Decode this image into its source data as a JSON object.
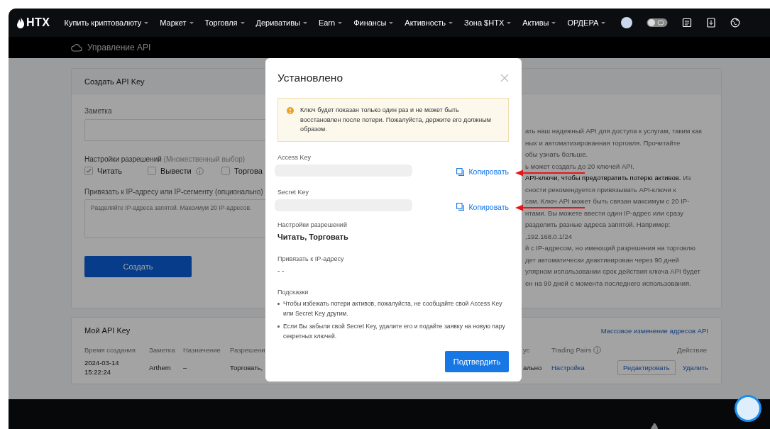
{
  "nav": {
    "logo": "HTX",
    "items": [
      {
        "label": "Купить криптовалюту"
      },
      {
        "label": "Маркет"
      },
      {
        "label": "Торговля"
      },
      {
        "label": "Деривативы"
      },
      {
        "label": "Earn"
      },
      {
        "label": "Финансы"
      },
      {
        "label": "Активность"
      },
      {
        "label": "Зона $HTX"
      },
      {
        "label": "Активы"
      },
      {
        "label": "ОРДЕРА"
      }
    ]
  },
  "subheader": {
    "title": "Управление API"
  },
  "create_panel": {
    "title": "Создать API Key",
    "note_label": "Заметка",
    "permissions_label": "Настройки разрешений",
    "permissions_hint": "(Множественный выбор)",
    "permissions": [
      {
        "label": "Читать",
        "checked": true,
        "info": false
      },
      {
        "label": "Вывести",
        "checked": false,
        "info": true
      },
      {
        "label": "Торгова",
        "checked": false,
        "info": false
      }
    ],
    "ip_label": "Привязать к IP-адресу или IP-сегменту (опционально)",
    "ip_placeholder": "Разделяйте IP-адреса запятой. Максимум 20 IP-адресов.",
    "create_button": "Создать",
    "info_lines": [
      "ать наш надежный API для доступа к услугам, таким как",
      "ных и автоматизированная торговля. Прочитайте",
      "обы узнать больше.",
      "ь может создать до 20 ключей API.",
      "**API-ключи, чтобы предотвратить потерю активов.** Из",
      "сности рекомендуется привязывать API-ключи к",
      "сам. Ключ API может быть связан максимум с 20 IP-",
      "нтами. Вы можете ввести один IP-адрес или сразу",
      "разделить разные адреса запятой. Например:",
      ",192.168.0.1/24",
      "й с IP-адресом, но имеющий разрешения на торговлю",
      "дет автоматически деактивирован через 90 дней",
      "улярном использовании срок действия ключа API будет",
      "ен на 90 дней с момента последнего использования."
    ]
  },
  "keys_panel": {
    "title": "Мой API Key",
    "bulk_link": "Массовое изменение адресов API",
    "columns": [
      {
        "label": "Время создания",
        "info": false
      },
      {
        "label": "Заметка",
        "info": false
      },
      {
        "label": "Назначение",
        "info": false
      },
      {
        "label": "Разрешени",
        "info": false
      },
      {
        "label": "ус",
        "info": false
      },
      {
        "label": "Trading Pairs",
        "info": true
      },
      {
        "label": "Действие",
        "info": false
      }
    ],
    "rows": [
      {
        "created": [
          "2024-03-14",
          "15:22:24"
        ],
        "note": "Arthem",
        "purpose": "–",
        "permissions": "Торговать,",
        "status": "ально",
        "pairs_link": "Настройка",
        "actions": [
          {
            "kind": "outline",
            "label": "Редактировать"
          },
          {
            "kind": "link",
            "label": "Удалить"
          }
        ]
      }
    ]
  },
  "modal": {
    "title": "Установлено",
    "warning": "Ключ будет показан только один раз и не может быть восстановлен после потери. Пожалуйста, держите его должным образом.",
    "keys": [
      {
        "label": "Access Key",
        "copy": "Копировать",
        "highlighted": true
      },
      {
        "label": "Secret Key",
        "copy": "Копировать",
        "highlighted": true
      }
    ],
    "permissions_label": "Настройки разрешений",
    "permissions_value": "Читать, Торговать",
    "ip_label": "Привязать к IP-адресу",
    "ip_value": "- -",
    "tips_title": "Подсказки",
    "tips": [
      "Чтобы избежать потери активов, пожалуйста, не сообщайте свой Access Key или Secret Key другим.",
      "Если Вы забыли свой Secret Key, удалите его и подайте заявку на новую пару секретных ключей."
    ],
    "confirm_button": "Подтвердить"
  }
}
